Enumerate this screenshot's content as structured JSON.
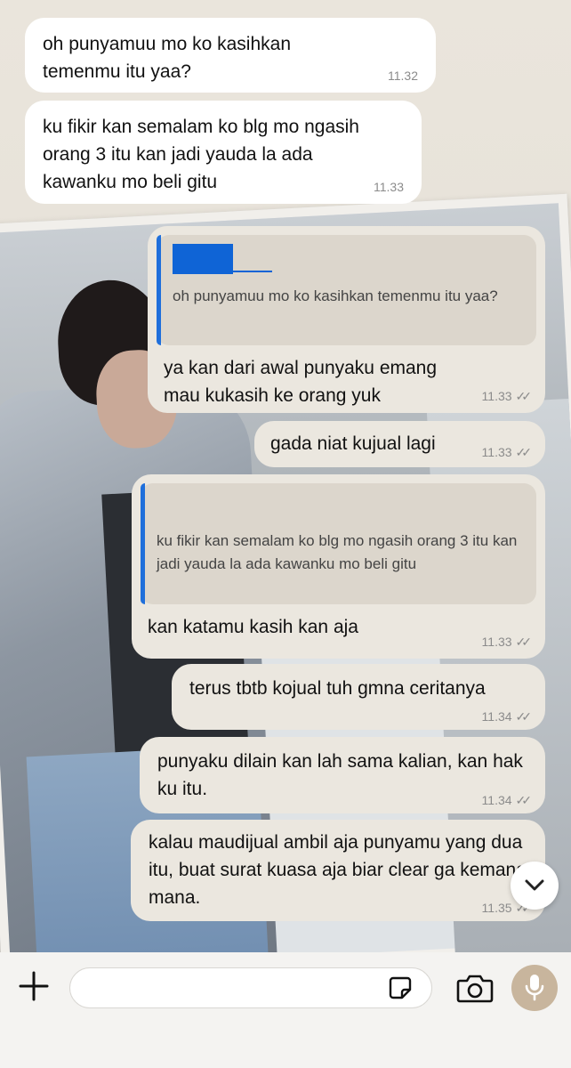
{
  "messages": [
    {
      "direction": "in",
      "text": "oh punyamuu mo ko kasihkan temenmu itu yaa?",
      "time": "11.32"
    },
    {
      "direction": "in",
      "text": "ku fikir kan semalam ko blg mo ngasih orang 3 itu kan jadi yauda la ada kawanku mo beli gitu",
      "time": "11.33"
    },
    {
      "direction": "out",
      "quote": "oh punyamuu mo ko kasihkan temenmu itu yaa?",
      "text": "ya kan dari awal punyaku emang mau kukasih ke orang yuk",
      "time": "11.33",
      "status": "read"
    },
    {
      "direction": "out",
      "text": "gada niat kujual lagi",
      "time": "11.33",
      "status": "read"
    },
    {
      "direction": "out",
      "quote": "ku fikir kan semalam ko blg mo ngasih orang 3 itu kan jadi yauda la ada kawanku mo beli gitu",
      "text": "kan katamu kasih kan aja",
      "time": "11.33",
      "status": "read"
    },
    {
      "direction": "out",
      "text": "terus tbtb kojual tuh gmna ceritanya",
      "time": "11.34",
      "status": "read"
    },
    {
      "direction": "out",
      "text": "punyaku dilain kan lah sama kalian, kan hak ku itu.",
      "time": "11.34",
      "status": "read"
    },
    {
      "direction": "out",
      "text": "kalau maudijual ambil aja punyamu yang dua itu, buat surat kuasa aja biar clear ga kemana mana.",
      "time": "11.35",
      "status": "read"
    }
  ],
  "input": {
    "value": "",
    "placeholder": ""
  },
  "icons": {
    "attach": "plus-icon",
    "sticker": "sticker-icon",
    "camera": "camera-icon",
    "mic": "microphone-icon",
    "scroll": "chevron-down-icon",
    "read_receipt": "double-check-icon"
  },
  "colors": {
    "incoming_bubble": "#ffffff",
    "outgoing_bubble": "#ebe7df",
    "quote_accent": "#1f6fdb",
    "mic_button": "#c8b59d"
  }
}
